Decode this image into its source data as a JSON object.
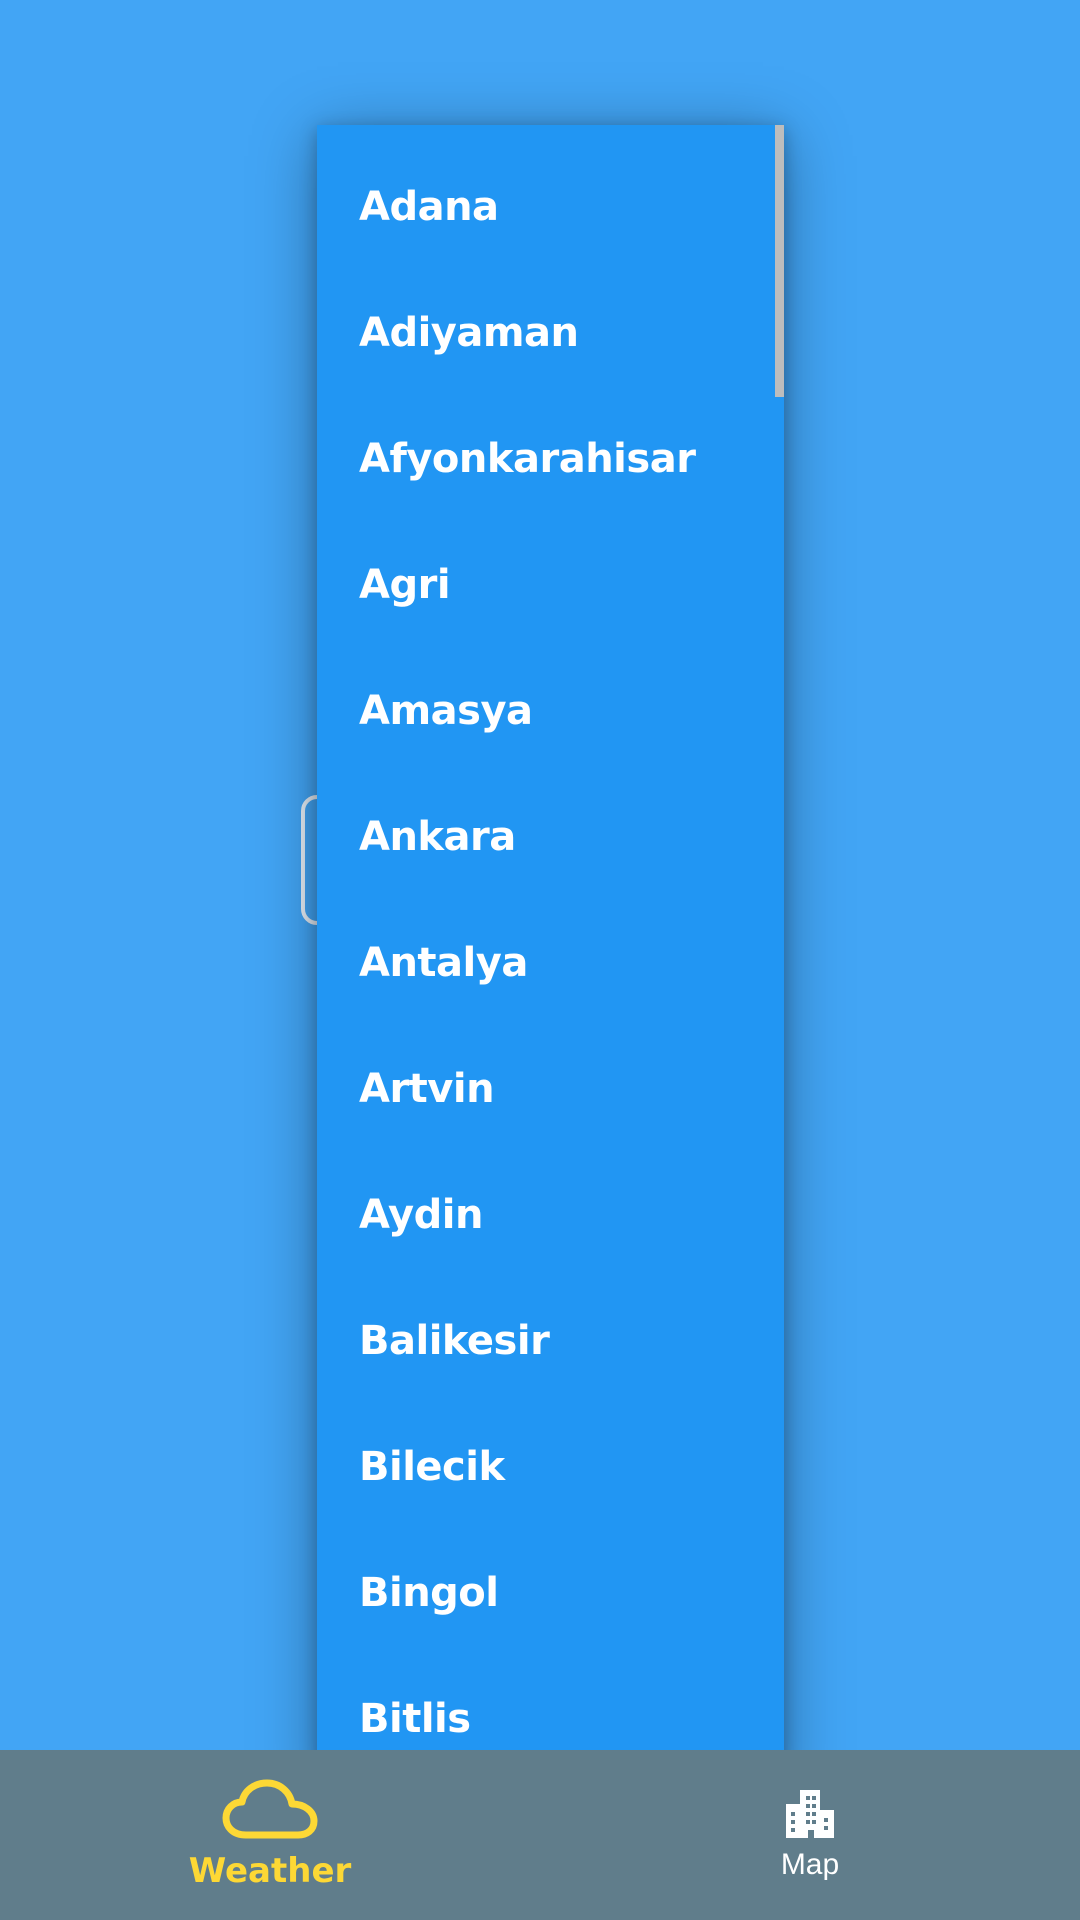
{
  "dropdown": {
    "items": [
      {
        "label": "Adana"
      },
      {
        "label": "Adiyaman"
      },
      {
        "label": "Afyonkarahisar"
      },
      {
        "label": "Agri"
      },
      {
        "label": "Amasya"
      },
      {
        "label": "Ankara"
      },
      {
        "label": "Antalya"
      },
      {
        "label": "Artvin"
      },
      {
        "label": "Aydin"
      },
      {
        "label": "Balikesir"
      },
      {
        "label": "Bilecik"
      },
      {
        "label": "Bingol"
      },
      {
        "label": "Bitlis"
      }
    ]
  },
  "bottom_nav": {
    "items": [
      {
        "label": "Weather",
        "icon": "cloud-icon",
        "selected": true
      },
      {
        "label": "Map",
        "icon": "city-icon",
        "selected": false
      }
    ]
  },
  "colors": {
    "background": "#42a5f5",
    "dropdown_bg": "#2196f3",
    "nav_bg": "#607d8b",
    "accent": "#fdd835"
  }
}
